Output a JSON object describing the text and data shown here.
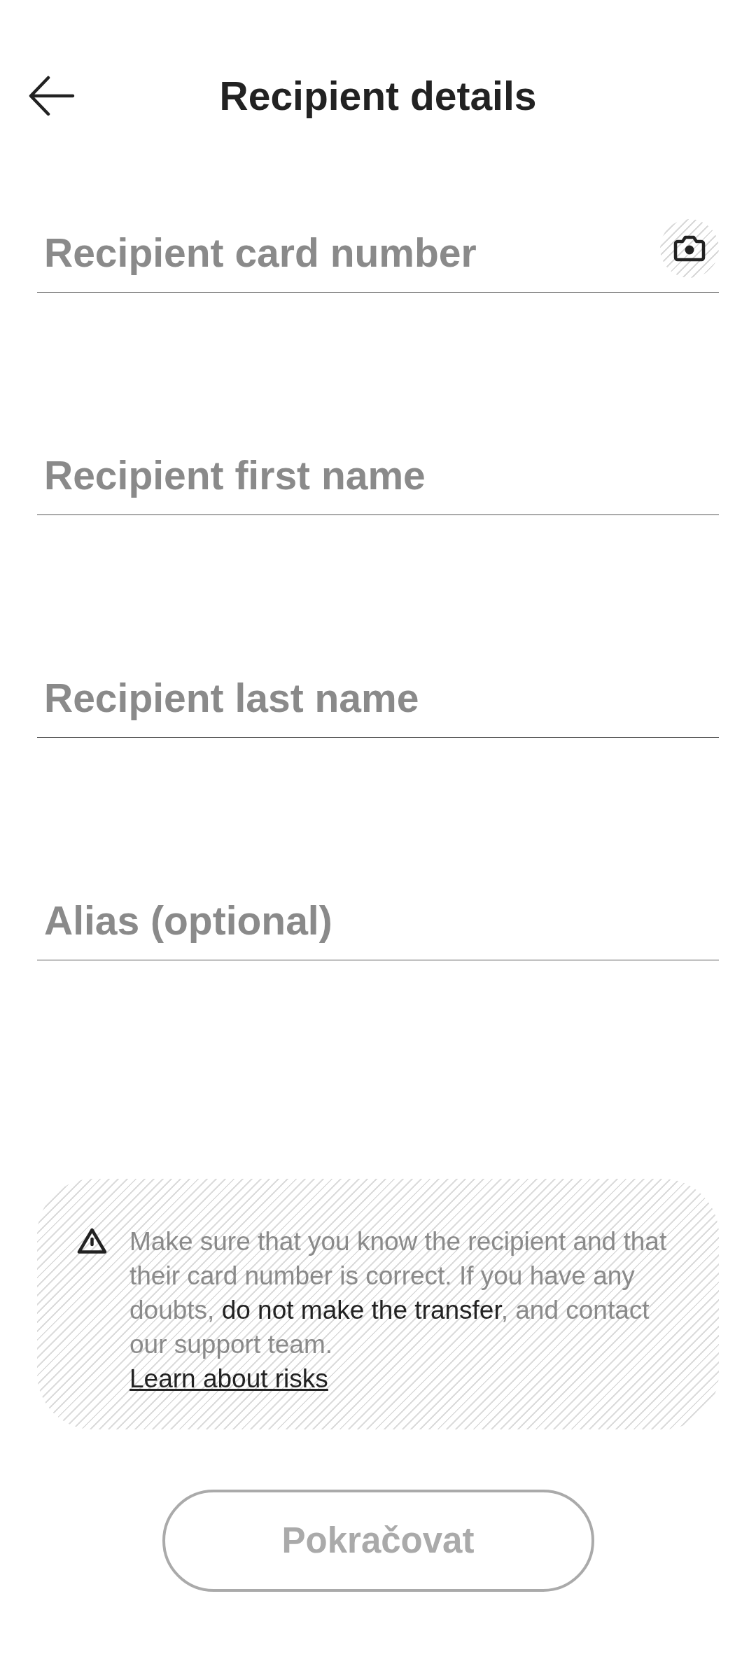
{
  "header": {
    "title": "Recipient details"
  },
  "fields": [
    {
      "placeholder": "Recipient card number",
      "kind": "scan"
    },
    {
      "placeholder": "Recipient first name",
      "kind": "text"
    },
    {
      "placeholder": "Recipient last name",
      "kind": "text"
    },
    {
      "placeholder": "Alias (optional)",
      "kind": "text"
    }
  ],
  "notice": {
    "text": "Make sure that you know the recipient and that their card number is correct. If you have any doubts, **do not make the transfer**, and contact our support team.",
    "link": "Learn about risks"
  },
  "continue_button": {
    "label": "Pokračovat",
    "disabled": true
  }
}
